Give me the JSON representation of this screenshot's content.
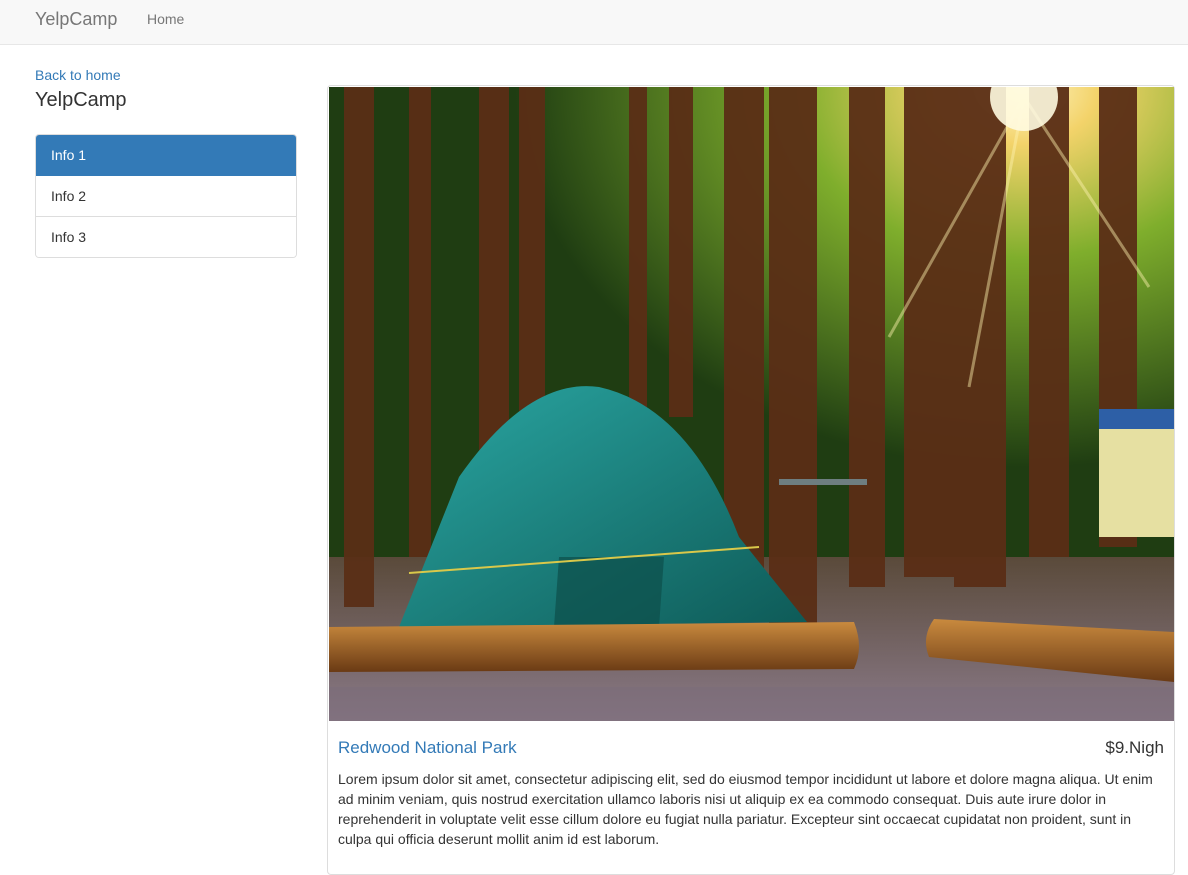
{
  "navbar": {
    "brand": "YelpCamp",
    "home_link": "Home"
  },
  "sidebar": {
    "back_link": "Back to home",
    "title": "YelpCamp",
    "items": [
      {
        "label": "Info 1",
        "active": true
      },
      {
        "label": "Info 2",
        "active": false
      },
      {
        "label": "Info 3",
        "active": false
      }
    ]
  },
  "campground": {
    "name": "Redwood National Park",
    "price": "$9.Nigh",
    "description": "Lorem ipsum dolor sit amet, consectetur adipiscing elit, sed do eiusmod tempor incididunt ut labore et dolore magna aliqua. Ut enim ad minim veniam, quis nostrud exercitation ullamco laboris nisi ut aliquip ex ea commodo consequat. Duis aute irure dolor in reprehenderit in voluptate velit esse cillum dolore eu fugiat nulla pariatur. Excepteur sint occaecat cupidatat non proident, sunt in culpa qui officia deserunt mollit anim id est laborum."
  },
  "colors": {
    "accent": "#337ab7",
    "navbar_bg": "#f8f8f8"
  }
}
